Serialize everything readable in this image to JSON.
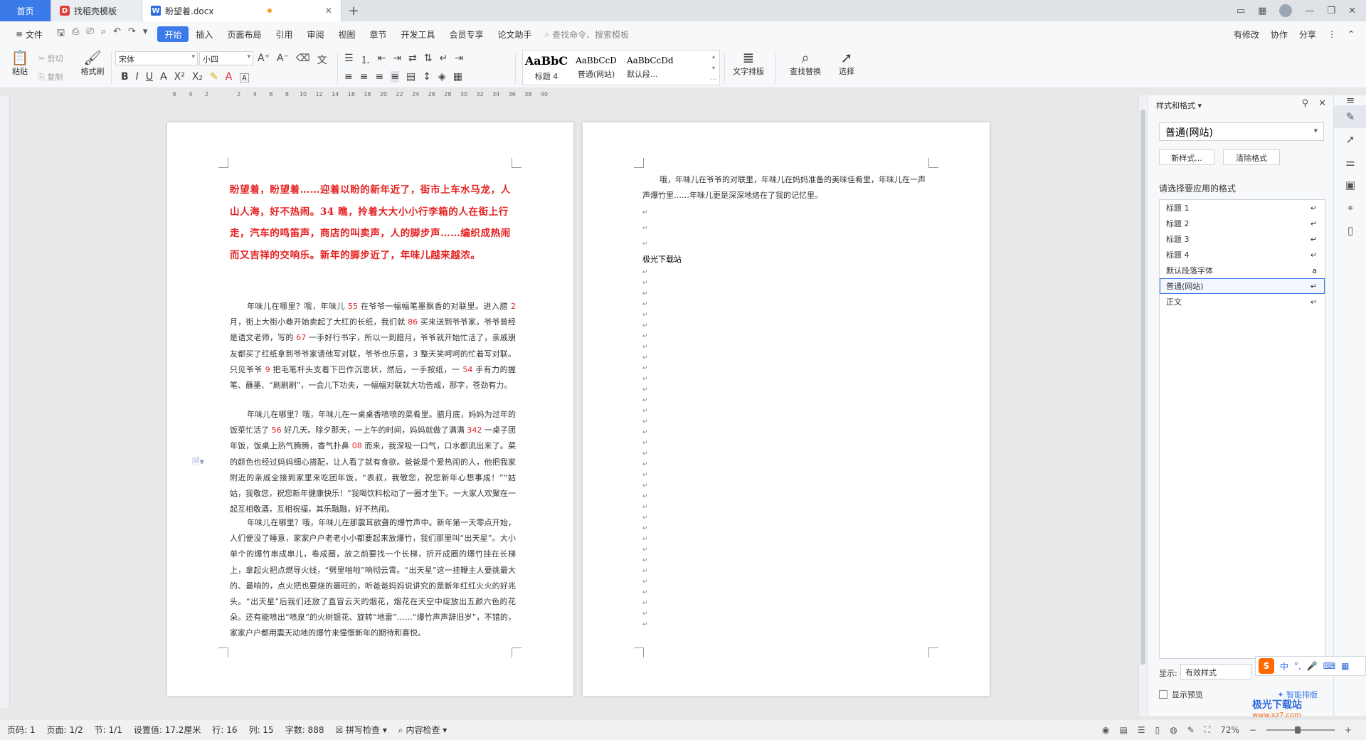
{
  "tabs": {
    "home": "首页",
    "template": "找稻壳模板",
    "doc": "盼望着.docx"
  },
  "menu": {
    "file": "文件",
    "items": [
      "开始",
      "插入",
      "页面布局",
      "引用",
      "审阅",
      "视图",
      "章节",
      "开发工具",
      "会员专享",
      "论文助手"
    ],
    "search": "查找命令、搜索模板",
    "right": [
      "有修改",
      "协作",
      "分享"
    ]
  },
  "ribbon": {
    "paste": "粘贴",
    "cut": "剪切",
    "copy": "复制",
    "format_painter": "格式刷",
    "font": "宋体",
    "size": "小四",
    "styles": [
      {
        "preview": "AaBbC",
        "label": "标题 4"
      },
      {
        "preview": "AaBbCcD",
        "label": "普通(网站)"
      },
      {
        "preview": "AaBbCcDd",
        "label": "默认段..."
      }
    ],
    "text_layout": "文字排版",
    "find_replace": "查找替换",
    "select": "选择"
  },
  "ruler": [
    "6",
    "4",
    "2",
    "",
    "2",
    "4",
    "6",
    "8",
    "10",
    "12",
    "14",
    "16",
    "18",
    "20",
    "22",
    "24",
    "26",
    "28",
    "30",
    "32",
    "34",
    "36",
    "38",
    "40"
  ],
  "page1": {
    "title": "盼望着，盼望着……迎着以盼的新年近了，街市上车水马龙，人山人海，好不热闹。34 瞧，拎着大大小小行李箱的人在街上行走，汽车的鸣笛声，商店的叫卖声，人的脚步声……编织成热闹而又吉祥的交响乐。新年的脚步近了，年味儿越来越浓。",
    "p1": "年味儿在哪里？哦，年味儿 55 在爷爷一幅幅笔墨飘香的对联里。进入腊 2 月，街上大街小巷开始卖起了大红的长纸，我们就 86 买来送到爷爷家。爷爷曾经是语文老师，写的 67 一手好行书字，所以一到腊月，爷爷就开始忙活了，亲戚朋友都买了红纸拿到爷爷家请他写对联，爷爷也乐意，3 整天笑呵呵的忙着写对联。只见爷爷 9 把毛笔杆头支着下巴作沉思状，然后，一手按纸，一 54 手有力的握笔、蘸墨、“刷刷刷”，一会儿下功夫，一幅幅对联就大功告成，那字，苍劲有力。",
    "p2": "年味儿在哪里？哦，年味儿在一桌桌香喷喷的菜肴里。腊月底，妈妈为过年的饭菜忙活了 56 好几天。除夕那天，一上午的时间，妈妈就做了满满 342 一桌子团年饭，饭桌上热气腾腾，香气扑鼻 08 而来，我深吸一口气，口水都流出来了。菜的颜色也经过妈妈细心搭配，让人看了就有食欲。爸爸是个爱热闹的人，他把我家附近的亲戚全接到家里来吃团年饭，“表叔，我敬您，祝您新年心想事成！”“姑姑，我敬您，祝您新年健康快乐！”我喝饮料松动了一圈才坐下。一大家人欢聚在一起互相敬酒，互相祝福，其乐融融，好不热闹。",
    "p3": "年味儿在哪里？哦，年味儿在那震耳欲聋的爆竹声中。新年第一天零点开始，人们便没了睡意，家家户户老老小小都要起来放爆竹，我们那里叫“出天星”。大小单个的爆竹串成串儿，卷成圈，放之前要找一个长梯，折开成圈的爆竹挂在长梯上，拿起火把点燃导火线，“劈里啪啦”响彻云霄。“出天星”这一挂鞭主人要挑最大的、最响的，点火把也要烧的最旺的，听爸爸妈妈说讲究的是新年红红火火的好兆头。“出天星”后我们还放了直冒云天的烟花，烟花在天空中绽放出五颜六色的花朵。还有能喷出“喷泉”的火树银花、旋转“地雷”……“爆竹声声辞旧岁”，不错的，家家户户都用震天动地的爆竹来憧憬新年的期待和喜悦。"
  },
  "page2": {
    "text": "哦，年味儿在爷爷的对联里，年味儿在妈妈准备的美味佳肴里，年味儿在一声声爆竹里……年味儿更是深深地烙在了我的记忆里。",
    "site": "极光下载站"
  },
  "panel": {
    "title": "样式和格式",
    "current": "普通(网站)",
    "new_style": "新样式...",
    "clear_format": "清除格式",
    "choose_label": "请选择要应用的格式",
    "items": [
      {
        "name": "标题 1",
        "mark": "↵"
      },
      {
        "name": "标题 2",
        "mark": "↵"
      },
      {
        "name": "标题 3",
        "mark": "↵"
      },
      {
        "name": "标题 4",
        "mark": "↵"
      },
      {
        "name": "默认段落字体",
        "mark": "a"
      },
      {
        "name": "普通(网站)",
        "mark": "↵"
      },
      {
        "name": "正文",
        "mark": "↵"
      }
    ],
    "show_label": "显示:",
    "show_value": "有效样式",
    "preview_label": "显示预览",
    "smart_layout": "智能排版"
  },
  "status": {
    "page_num": "页码: 1",
    "page": "页面: 1/2",
    "section": "节: 1/1",
    "setting": "设置值: 17.2厘米",
    "row": "行: 16",
    "col": "列: 15",
    "words": "字数: 888",
    "spell": "拼写检查",
    "content_check": "内容检查",
    "zoom": "72%"
  },
  "watermark": {
    "name": "极光下载站",
    "url": "www.xz7.com"
  }
}
